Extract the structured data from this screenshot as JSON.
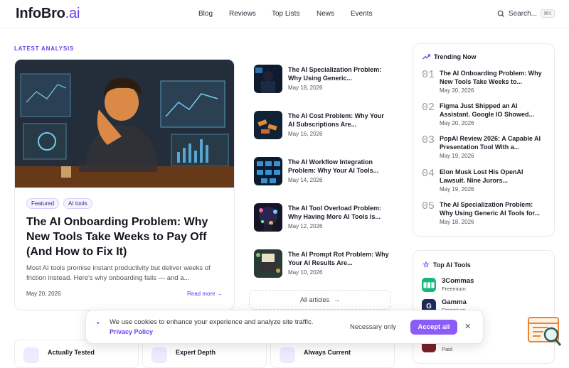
{
  "header": {
    "logo_main": "InfoBro",
    "logo_suffix": ".ai",
    "nav": [
      "Blog",
      "Reviews",
      "Top Lists",
      "News",
      "Events"
    ],
    "search_label": "Search...",
    "search_shortcut": "⌘K"
  },
  "section_label": "LATEST ANALYSIS",
  "featured": {
    "tags": [
      "Featured",
      "AI tools"
    ],
    "title": "The AI Onboarding Problem: Why New Tools Take Weeks to Pay Off (And How to Fix It)",
    "description": "Most AI tools promise instant productivity but deliver weeks of friction instead. Here's why onboarding fails — and a...",
    "date": "May 20, 2026",
    "read_more": "Read more →"
  },
  "articles": [
    {
      "title": "The AI Specialization Problem: Why Using Generic...",
      "date": "May 18, 2026"
    },
    {
      "title": "The AI Cost Problem: Why Your AI Subscriptions Are...",
      "date": "May 16, 2026"
    },
    {
      "title": "The AI Workflow Integration Problem: Why Your AI Tools...",
      "date": "May 14, 2026"
    },
    {
      "title": "The AI Tool Overload Problem: Why Having More AI Tools Is...",
      "date": "May 12, 2026"
    },
    {
      "title": "The AI Prompt Rot Problem: Why Your AI Results Are...",
      "date": "May 10, 2026"
    }
  ],
  "all_articles": "All articles",
  "trending": {
    "heading": "Trending Now",
    "items": [
      {
        "num": "01",
        "title": "The AI Onboarding Problem: Why New Tools Take Weeks to...",
        "date": "May 20, 2026"
      },
      {
        "num": "02",
        "title": "Figma Just Shipped an AI Assistant. Google IO Showed...",
        "date": "May 20, 2026"
      },
      {
        "num": "03",
        "title": "PopAI Review 2026: A Capable AI Presentation Tool With a...",
        "date": "May 19, 2026"
      },
      {
        "num": "04",
        "title": "Elon Musk Lost His OpenAI Lawsuit. Nine Jurors...",
        "date": "May 19, 2026"
      },
      {
        "num": "05",
        "title": "The AI Specialization Problem: Why Using Generic AI Tools for...",
        "date": "May 18, 2026"
      }
    ]
  },
  "top_tools": {
    "heading": "Top AI Tools",
    "items": [
      {
        "name": "3Commas",
        "sub": "Freemium",
        "color": "#14b87a",
        "glyph": "▮▮▮"
      },
      {
        "name": "Gamma",
        "sub": "Freemium",
        "color": "#1f2a5a",
        "glyph": "G"
      },
      {
        "name": "",
        "sub": "Paid",
        "color": "#7a1f2a",
        "glyph": ""
      }
    ]
  },
  "features": [
    "Actually Tested",
    "Expert Depth",
    "Always Current"
  ],
  "cookie": {
    "text": "We use cookies to enhance your experience and analyze site traffic.",
    "policy": "Privacy Policy",
    "necessary": "Necessary only",
    "accept": "Accept all",
    "close": "✕"
  }
}
